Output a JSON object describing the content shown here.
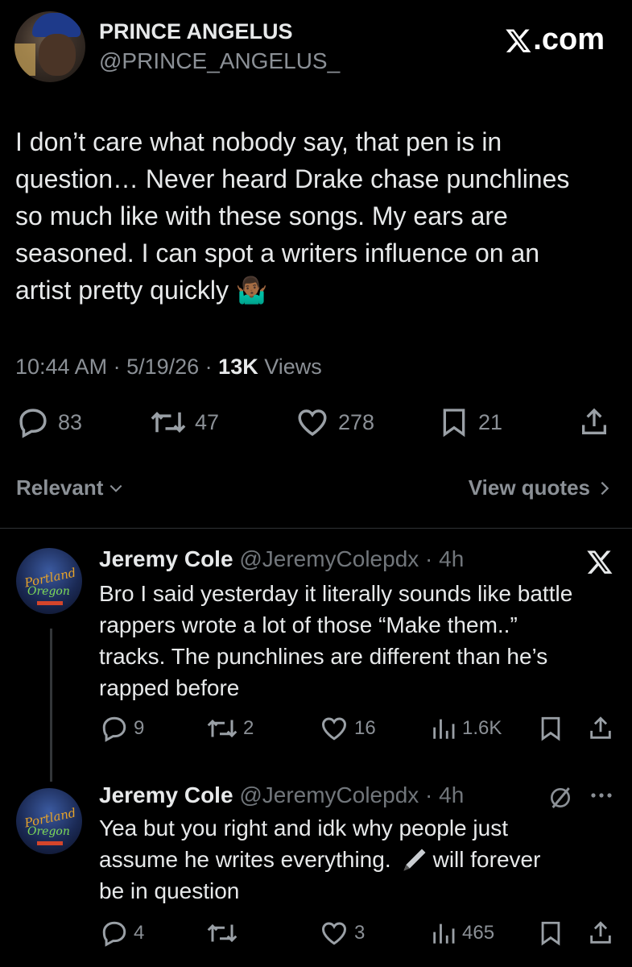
{
  "tweet": {
    "author_name": "PRINCE ANGELUS",
    "author_handle": "@PRINCE_ANGELUS_",
    "site": "X.com",
    "lines": [
      "I don’t care what nobody say, that pen is in",
      "question… Never heard Drake chase punchlines",
      "so much like with these songs. My ears are",
      "seasoned. I can spot a writers influence on an",
      "artist pretty quickly 🤷🏾‍♂️"
    ],
    "time": "10:44 AM",
    "date": "5/19/26",
    "views_count": "13K",
    "views_label": "Views",
    "replies": "83",
    "reposts": "47",
    "likes": "278",
    "bookmarks": "21",
    "sort_label": "Relevant",
    "view_quotes": "View quotes"
  },
  "replies": [
    {
      "name": "Jeremy Cole",
      "handle": "@JeremyColepdx",
      "age": "4h",
      "lines": [
        "Bro I said yesterday it literally sounds like battle",
        "rappers wrote a lot of those “Make them..”",
        "tracks. The punchlines are different than he’s",
        "rapped before"
      ],
      "replies": "9",
      "reposts": "2",
      "likes": "16",
      "views": "1.6K",
      "avatar_text_1": "Portland",
      "avatar_text_2": "Oregon"
    },
    {
      "name": "Jeremy Cole",
      "handle": "@JeremyColepdx",
      "age": "4h",
      "line1": "Yea but you right and idk why people just",
      "line2a": "assume he writes everything.",
      "line2b": "will forever",
      "line3": "be in question",
      "replies": "4",
      "reposts": "",
      "likes": "3",
      "views": "465",
      "avatar_text_1": "Portland",
      "avatar_text_2": "Oregon"
    }
  ],
  "colors": {
    "background": "#000000",
    "text": "#e7e9ea",
    "muted": "#71767b",
    "divider": "#2f3336"
  },
  "icons": [
    "reply-icon",
    "repost-icon",
    "like-icon",
    "bookmark-icon",
    "share-icon",
    "views-icon",
    "x-logo-icon",
    "grok-icon",
    "more-icon",
    "chevron-down-icon",
    "chevron-right-icon"
  ]
}
